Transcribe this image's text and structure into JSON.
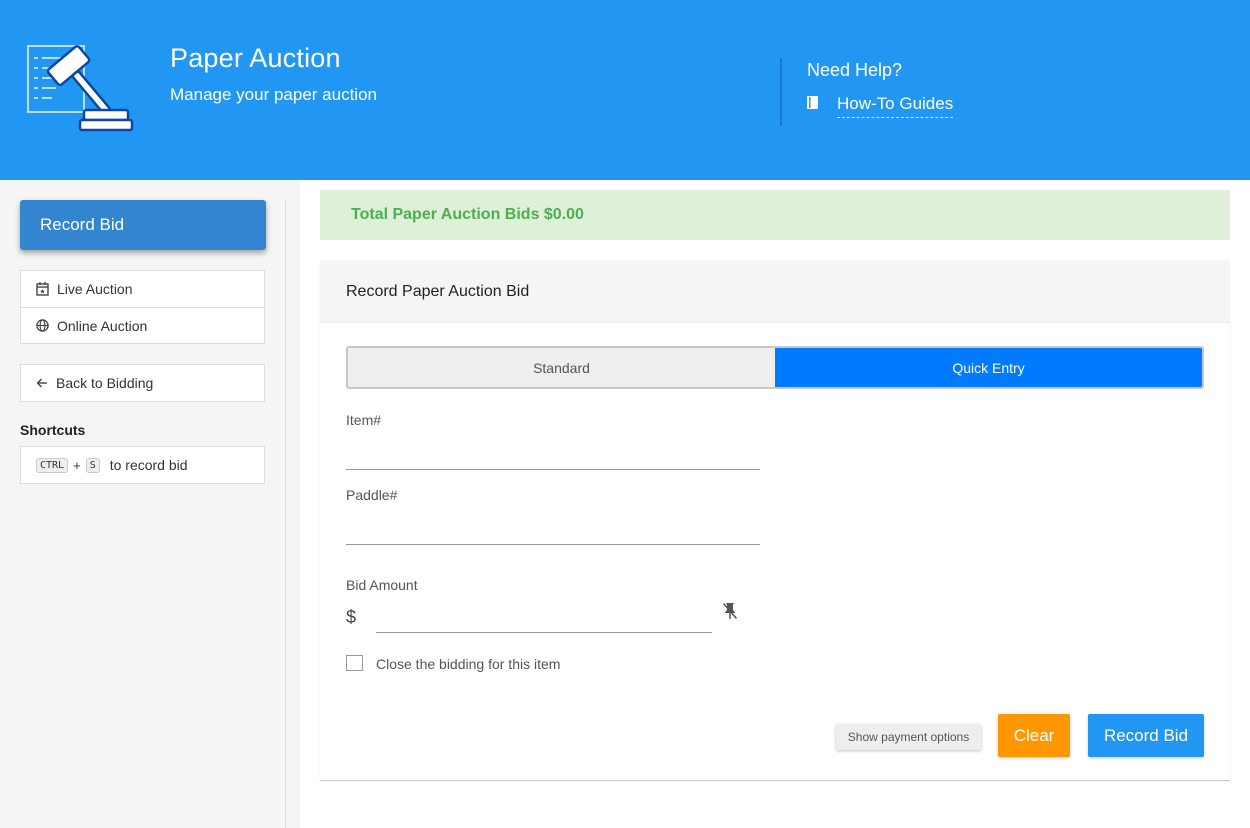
{
  "header": {
    "title": "Paper Auction",
    "subtitle": "Manage your paper auction",
    "logo_icon": "gavel-auction-icon",
    "help": {
      "title": "Need Help?",
      "link_label": "How-To Guides",
      "icon": "book-icon"
    }
  },
  "sidebar": {
    "primary_label": "Record Bid",
    "nav": [
      {
        "label": "Live Auction",
        "icon": "calendar-icon"
      },
      {
        "label": "Online Auction",
        "icon": "globe-icon"
      }
    ],
    "back_label": "Back to Bidding",
    "shortcuts": {
      "title": "Shortcuts",
      "key1": "CTRL",
      "plus": "+",
      "key2": "S",
      "text": "to record bid"
    }
  },
  "main": {
    "total_banner": "Total Paper Auction Bids $0.00",
    "card_title": "Record Paper Auction Bid",
    "tabs": [
      {
        "label": "Standard",
        "active": false
      },
      {
        "label": "Quick Entry",
        "active": true
      }
    ],
    "fields": {
      "item_label": "Item#",
      "item_value": "",
      "paddle_label": "Paddle#",
      "paddle_value": "",
      "amount_label": "Bid Amount",
      "currency_symbol": "$",
      "amount_value": ""
    },
    "close_checkbox": {
      "label": "Close the bidding for this item",
      "checked": false
    },
    "buttons": {
      "payment": "Show payment options",
      "clear": "Clear",
      "record": "Record Bid"
    }
  },
  "colors": {
    "header": "#2196f3",
    "accent_blue": "#007bff",
    "clear": "#ff9800",
    "success_bg": "#dff0d8",
    "success_text": "#4caf50"
  }
}
